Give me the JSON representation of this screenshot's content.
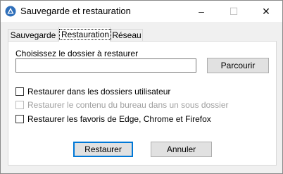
{
  "window": {
    "title": "Sauvegarde et restauration",
    "controls": {
      "minimize": "–",
      "maximize": "☐",
      "close": "✕"
    }
  },
  "tabs": [
    {
      "label": "Sauvegarde",
      "active": false
    },
    {
      "label": "Restauration",
      "active": true
    },
    {
      "label": "Réseau",
      "active": false
    }
  ],
  "restore": {
    "folder_label": "Choisissez le dossier à restaurer",
    "folder_value": "",
    "browse_label": "Parcourir",
    "options": [
      {
        "label": "Restaurer dans les dossiers utilisateur",
        "checked": false,
        "enabled": true
      },
      {
        "label": "Restaurer le contenu du bureau dans un sous dossier",
        "checked": false,
        "enabled": false
      },
      {
        "label": "Restaurer les favoris de Edge, Chrome et Firefox",
        "checked": false,
        "enabled": true
      }
    ],
    "restore_button": "Restaurer",
    "cancel_button": "Annuler"
  },
  "colors": {
    "accent": "#0078d7",
    "app_icon": "#2f6fba"
  }
}
